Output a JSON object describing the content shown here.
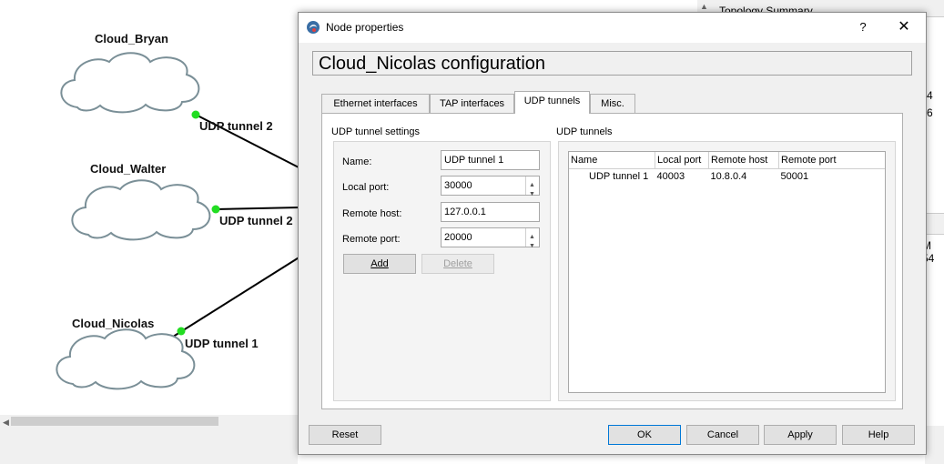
{
  "topology": {
    "nodes": [
      {
        "name": "Cloud_Bryan"
      },
      {
        "name": "Cloud_Walter"
      },
      {
        "name": "Cloud_Nicolas"
      }
    ],
    "links": [
      {
        "label": "UDP tunnel 2"
      },
      {
        "label": "UDP tunnel 2"
      },
      {
        "label": "UDP tunnel 1"
      }
    ],
    "link_color": "#22dd22"
  },
  "side_panel": {
    "title": "Topology Summary",
    "fragment_1": "4",
    "fragment_2": "6",
    "fragment_3": "M 54"
  },
  "dialog": {
    "window_title": "Node properties",
    "help_glyph": "?",
    "close_glyph": "✕",
    "config_title": "Cloud_Nicolas configuration",
    "tabs": [
      "Ethernet interfaces",
      "TAP interfaces",
      "UDP tunnels",
      "Misc."
    ],
    "active_tab": "UDP tunnels",
    "settings": {
      "group_title": "UDP tunnel settings",
      "name_label": "Name:",
      "name_value": "UDP tunnel 1",
      "local_port_label": "Local port:",
      "local_port_value": "30000",
      "remote_host_label": "Remote host:",
      "remote_host_value": "127.0.0.1",
      "remote_port_label": "Remote port:",
      "remote_port_value": "20000",
      "add_label": "Add",
      "delete_label": "Delete"
    },
    "tunnels": {
      "group_title": "UDP tunnels",
      "columns": [
        "Name",
        "Local port",
        "Remote host",
        "Remote port"
      ],
      "rows": [
        [
          "UDP tunnel 1",
          "40003",
          "10.8.0.4",
          "50001"
        ]
      ]
    },
    "buttons": {
      "reset": "Reset",
      "ok": "OK",
      "cancel": "Cancel",
      "apply": "Apply",
      "help": "Help"
    }
  }
}
